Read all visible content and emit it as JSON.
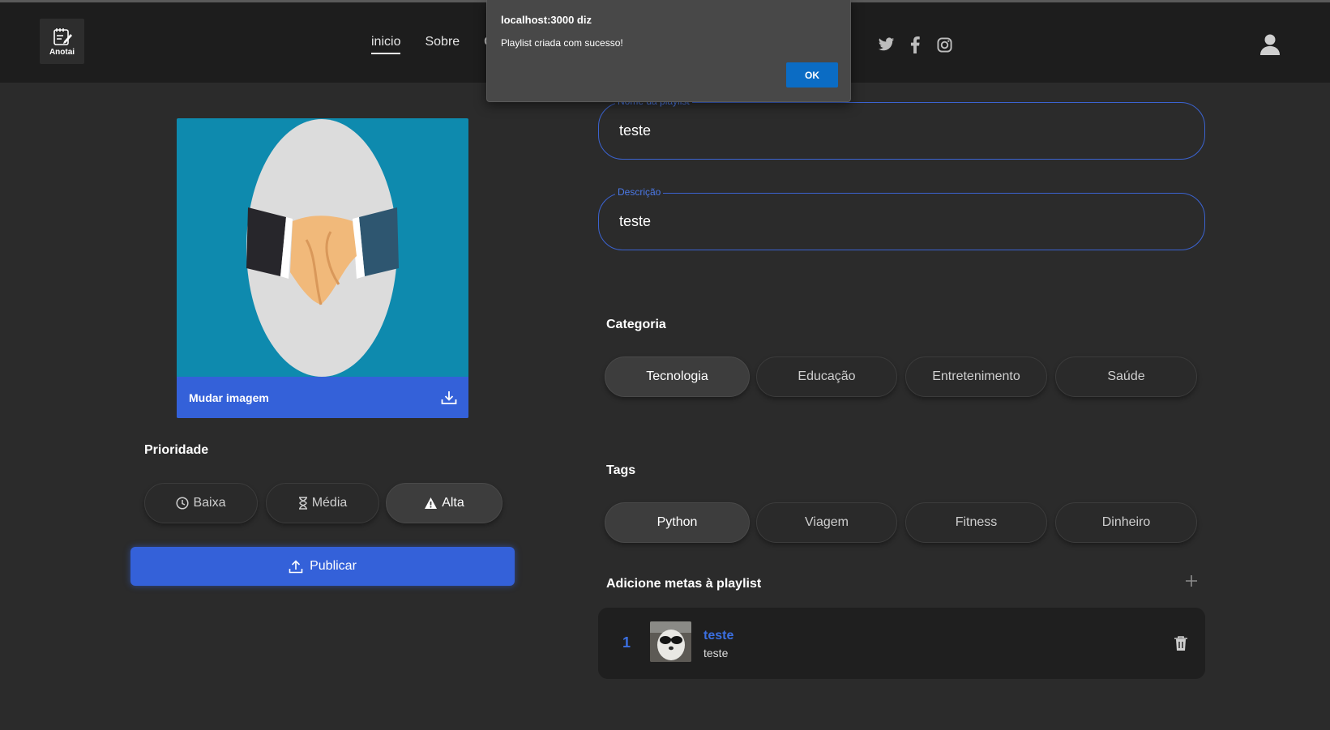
{
  "header": {
    "logo_text": "Anotai",
    "nav": [
      {
        "label": "inicio",
        "active": true
      },
      {
        "label": "Sobre",
        "active": false
      },
      {
        "label": "C",
        "active": false
      }
    ],
    "socials": [
      "twitter-icon",
      "facebook-icon",
      "instagram-icon"
    ]
  },
  "alert": {
    "title": "localhost:3000 diz",
    "message": "Playlist criada com sucesso!",
    "ok_label": "OK"
  },
  "image_card": {
    "change_label": "Mudar imagem"
  },
  "priority": {
    "title": "Prioridade",
    "options": [
      {
        "label": "Baixa",
        "icon": "clock-icon",
        "selected": false
      },
      {
        "label": "Média",
        "icon": "hourglass-icon",
        "selected": false
      },
      {
        "label": "Alta",
        "icon": "warning-icon",
        "selected": true
      }
    ]
  },
  "publish_label": "Publicar",
  "form": {
    "name_legend": "Nome da playlist",
    "name_value": "teste",
    "description_legend": "Descrição",
    "description_value": "teste"
  },
  "category": {
    "title": "Categoria",
    "options": [
      {
        "label": "Tecnologia",
        "selected": true
      },
      {
        "label": "Educação",
        "selected": false
      },
      {
        "label": "Entretenimento",
        "selected": false
      },
      {
        "label": "Saúde",
        "selected": false
      }
    ]
  },
  "tags": {
    "title": "Tags",
    "options": [
      {
        "label": "Python",
        "selected": true
      },
      {
        "label": "Viagem",
        "selected": false
      },
      {
        "label": "Fitness",
        "selected": false
      },
      {
        "label": "Dinheiro",
        "selected": false
      }
    ]
  },
  "goals": {
    "title": "Adicione metas à playlist",
    "items": [
      {
        "index": "1",
        "title": "teste",
        "description": "teste"
      }
    ]
  },
  "colors": {
    "accent": "#3461d9",
    "background": "#2b2b2b",
    "header": "#1d1d1d",
    "alert_button": "#0b6cc4"
  }
}
